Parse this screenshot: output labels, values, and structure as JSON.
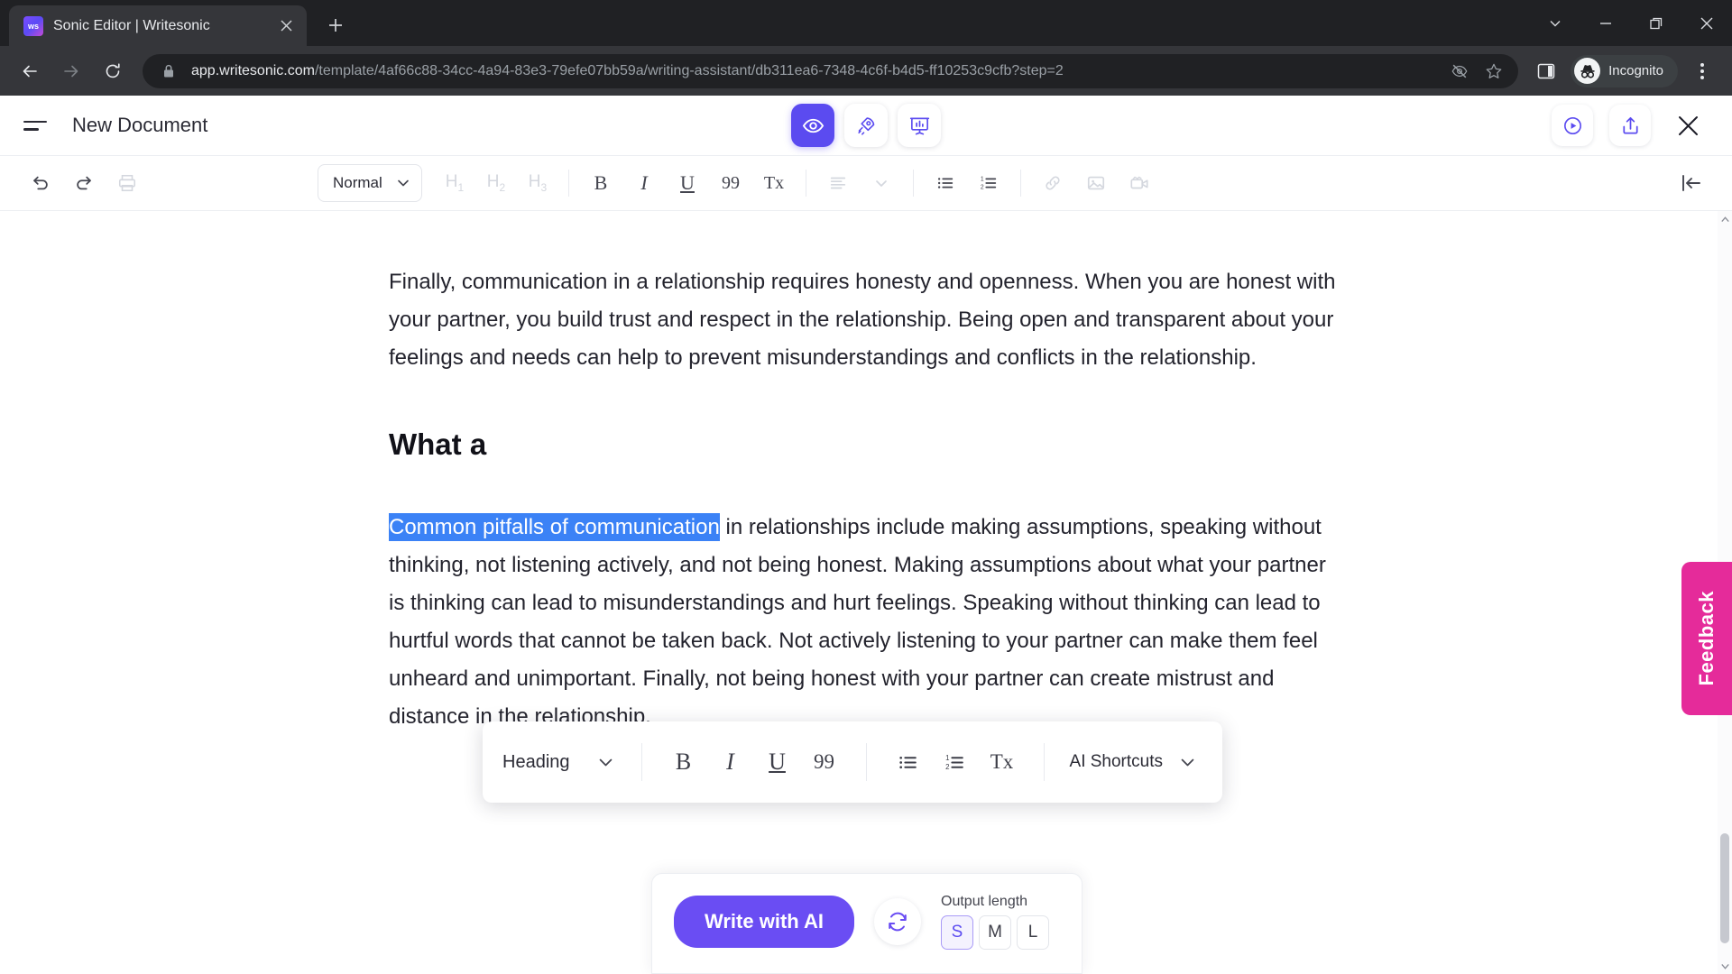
{
  "browser": {
    "tab": {
      "title": "Sonic Editor | Writesonic",
      "favicon_label": "ws",
      "close_icon": "close-icon"
    },
    "new_tab_icon": "plus-icon",
    "window_controls": [
      {
        "name": "chevron-down-icon",
        "glyph": "v"
      },
      {
        "name": "minimize-icon",
        "glyph": "—"
      },
      {
        "name": "restore-icon",
        "glyph": "❐"
      },
      {
        "name": "close-window-icon",
        "glyph": "✕"
      }
    ],
    "nav": {
      "back_icon": "back-arrow-icon",
      "forward_icon": "forward-arrow-icon",
      "reload_icon": "reload-icon"
    },
    "omnibox": {
      "lock_icon": "lock-icon",
      "url_domain": "app.writesonic.com",
      "url_path": "/template/4af66c88-34cc-4a94-83e3-79efe07bb59a/writing-assistant/db311ea6-7348-4c6f-b4d5-ff10253c9cfb?step=2",
      "tracking_protection_icon": "eye-slash-icon",
      "bookmark_icon": "star-icon"
    },
    "side_panel_icon": "side-panel-icon",
    "profile": {
      "label": "Incognito",
      "icon": "incognito-icon"
    },
    "menu_icon": "three-dot-menu-icon"
  },
  "app": {
    "header": {
      "menu_icon": "hamburger-menu-icon",
      "document_title": "New Document",
      "center_buttons": [
        {
          "name": "preview-eye-button",
          "icon": "eye-icon",
          "active": true
        },
        {
          "name": "boost-rocket-button",
          "icon": "rocket-icon",
          "active": false
        },
        {
          "name": "analytics-board-button",
          "icon": "presentation-chart-icon",
          "active": false
        }
      ],
      "right_buttons": [
        {
          "name": "play-button",
          "icon": "play-circle-icon"
        },
        {
          "name": "share-button",
          "icon": "share-upload-icon"
        }
      ],
      "close_icon": "close-icon"
    },
    "toolbar": {
      "undo_icon": "undo-icon",
      "redo_icon": "redo-icon",
      "print_icon": "print-icon",
      "style_value": "Normal",
      "style_caret_icon": "chevron-down-icon",
      "headings": [
        "H1",
        "H2",
        "H3"
      ],
      "heading_subs": [
        "1",
        "2",
        "3"
      ],
      "bold_label": "B",
      "italic_label": "I",
      "underline_label": "U",
      "quote_label": "99",
      "clear_format_label": "Tx",
      "align_icon": "align-left-icon",
      "align_caret_icon": "chevron-down-icon",
      "bullet_list_icon": "bullet-list-icon",
      "numbered_list_icon": "numbered-list-icon",
      "link_icon": "link-icon",
      "image_icon": "image-icon",
      "video_icon": "video-icon",
      "collapse_icon": "collapse-panel-icon"
    },
    "document": {
      "paragraph_1": "Finally, communication in a relationship requires honesty and openness. When you are honest with your partner, you build trust and respect in the relationship. Being open and transparent about your feelings and needs can help to prevent misunderstandings and conflicts in the relationship.",
      "heading_2": "What a",
      "paragraph_2_selected": "Common pitfalls of communication",
      "paragraph_2_rest": " in relationships include making assumptions, speaking without thinking, not listening actively, and not being honest. Making assumptions about what your partner is thinking can lead to misunderstandings and hurt feelings. Speaking without thinking can lead to hurtful words that cannot be taken back. Not actively listening to your partner can make them feel unheard and unimportant. Finally, not being honest with your partner can create mistrust and distance in the relationship.",
      "selection_color": "#3b82f6"
    },
    "bubble_toolbar": {
      "style_value": "Heading",
      "style_caret_icon": "chevron-down-icon",
      "bold_label": "B",
      "italic_label": "I",
      "underline_label": "U",
      "quote_label": "99",
      "bullet_list_icon": "bullet-list-icon",
      "numbered_list_icon": "numbered-list-icon",
      "clear_format_label": "Tx",
      "ai_shortcuts_label": "AI Shortcuts",
      "ai_caret_icon": "chevron-down-icon"
    },
    "ai_panel": {
      "write_button_label": "Write with AI",
      "refresh_icon": "refresh-icon",
      "output_length_label": "Output length",
      "length_options": [
        "S",
        "M",
        "L"
      ],
      "length_selected": "S"
    },
    "feedback_tab": {
      "label": "Feedback",
      "color": "#e52b9a"
    },
    "accent_color": "#5b4bf0"
  }
}
